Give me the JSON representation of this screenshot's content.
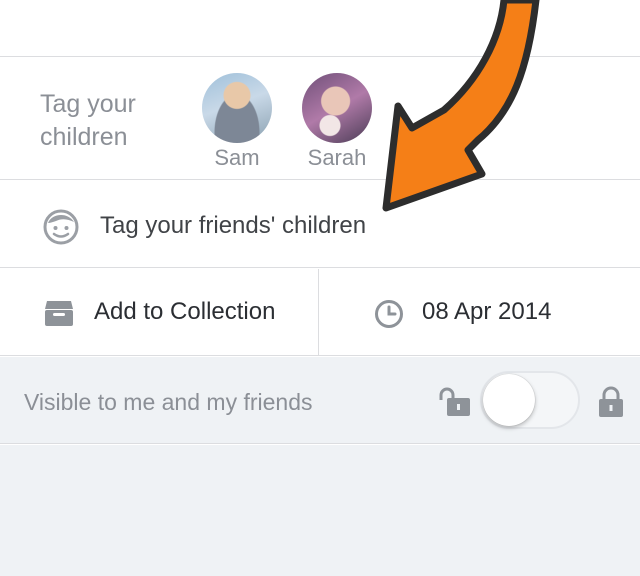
{
  "tag_children": {
    "label": "Tag your children",
    "children": [
      {
        "name": "Sam"
      },
      {
        "name": "Sarah"
      }
    ]
  },
  "friends_row": {
    "label": "Tag your friends' children",
    "icon": "child-face-icon"
  },
  "collection": {
    "label": "Add to Collection",
    "icon": "box-icon"
  },
  "date": {
    "value": "08 Apr 2014",
    "icon": "clock-icon"
  },
  "visibility": {
    "label": "Visible to me and my friends",
    "toggle_on": false,
    "left_icon": "unlock-icon",
    "right_icon": "lock-icon"
  },
  "annotation": {
    "arrow_color": "#f57f17",
    "arrow_outline": "#2d2d2d"
  }
}
